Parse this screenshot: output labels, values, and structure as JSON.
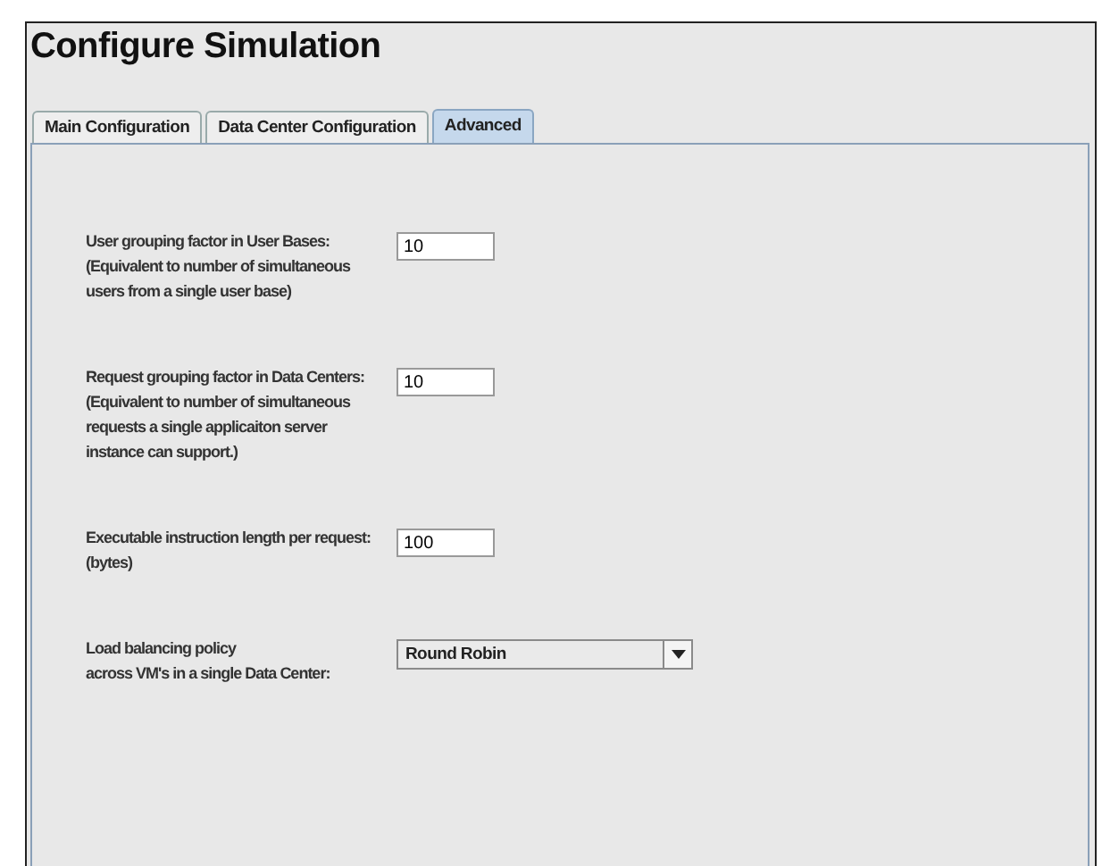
{
  "window": {
    "title": "Configure Simulation"
  },
  "tabs": [
    {
      "label": "Main Configuration",
      "selected": false
    },
    {
      "label": "Data Center Configuration",
      "selected": false
    },
    {
      "label": "Advanced",
      "selected": true
    }
  ],
  "settings": [
    {
      "kind": "text",
      "label_lines": [
        "User grouping factor in User Bases:",
        "(Equivalent to number of simultaneous",
        "users from a single user base)"
      ],
      "value": "10"
    },
    {
      "kind": "text",
      "label_lines": [
        "Request grouping factor in Data Centers:",
        "(Equivalent to number of simultaneous",
        "requests a single applicaiton server",
        "instance can support.)"
      ],
      "value": "10"
    },
    {
      "kind": "text",
      "label_lines": [
        "Executable instruction length per request:",
        "(bytes)"
      ],
      "value": "100"
    },
    {
      "kind": "dropdown",
      "label_lines": [
        "Load balancing policy",
        "across VM's in a single Data Center:"
      ],
      "value": "Round Robin"
    }
  ]
}
